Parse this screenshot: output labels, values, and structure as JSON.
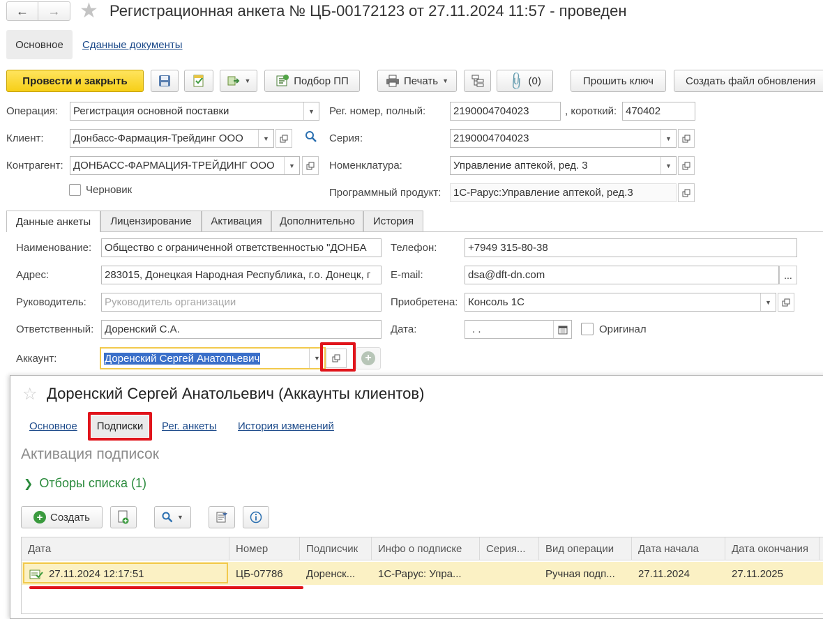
{
  "window": {
    "title": "Регистрационная анкета № ЦБ-00172123 от 27.11.2024 11:57 - проведен"
  },
  "top_nav": {
    "main_tab": "Основное",
    "docs_link": "Сданные документы"
  },
  "toolbar": {
    "post_close": "Провести и закрыть",
    "select_pp": "Подбор ПП",
    "print": "Печать",
    "attach_count": "(0)",
    "flash_key": "Прошить ключ",
    "create_update": "Создать файл обновления"
  },
  "form": {
    "operation_label": "Операция:",
    "operation_value": "Регистрация основной поставки",
    "client_label": "Клиент:",
    "client_value": "Донбасс-Фармация-Трейдинг ООО",
    "contractor_label": "Контрагент:",
    "contractor_value": "ДОНБАСС-ФАРМАЦИЯ-ТРЕЙДИНГ ООО",
    "draft_label": "Черновик",
    "reg_full_label": "Рег. номер, полный:",
    "reg_full_value": "2190004704023",
    "reg_short_label": ", короткий:",
    "reg_short_value": "470402",
    "series_label": "Серия:",
    "series_value": "2190004704023",
    "nomenclature_label": "Номенклатура:",
    "nomenclature_value": "Управление аптекой, ред. 3",
    "product_label": "Программный продукт:",
    "product_value": "1С-Рарус:Управление аптекой, ред.3"
  },
  "tabs": [
    "Данные анкеты",
    "Лицензирование",
    "Активация",
    "Дополнительно",
    "История"
  ],
  "anketa": {
    "name_label": "Наименование:",
    "name_value": "Общество с ограниченной ответственностью \"ДОНБА",
    "address_label": "Адрес:",
    "address_value": "283015, Донецкая Народная Республика, г.о. Донецк, г",
    "head_label": "Руководитель:",
    "head_placeholder": "Руководитель организации",
    "responsible_label": "Ответственный:",
    "responsible_value": "Доренский С.А.",
    "account_label": "Аккаунт:",
    "account_value": "Доренский Сергей Анатольевич",
    "phone_label": "Телефон:",
    "phone_value": "+7949 315-80-38",
    "email_label": "E-mail:",
    "email_value": "dsa@dft-dn.com",
    "email_btn": "...",
    "acquired_label": "Приобретена:",
    "acquired_value": "Консоль 1С",
    "date_label": "Дата:",
    "date_value": ". .",
    "original_label": "Оригинал"
  },
  "popup": {
    "title": "Доренский Сергей Анатольевич (Аккаунты клиентов)",
    "nav": [
      "Основное",
      "Подписки",
      "Рег. анкеты",
      "История изменений"
    ],
    "section_title": "Активация подписок",
    "filters": "Отборы списка (1)",
    "create_btn": "Создать",
    "columns": [
      "Дата",
      "Номер",
      "Подписчик",
      "Инфо о подписке",
      "Серия...",
      "Вид операции",
      "Дата начала",
      "Дата окончания"
    ],
    "rows": [
      [
        "27.11.2024 12:17:51",
        "ЦБ-07786",
        "Доренск...",
        "1С-Рарус: Упра...",
        "",
        "Ручная подп...",
        "27.11.2024",
        "27.11.2025"
      ]
    ]
  },
  "colors": {
    "primary_yellow": "#f6cf17",
    "highlight_red": "#e0141b",
    "row_highlight": "#fbf1c4",
    "link_blue": "#1c4a8a",
    "filter_green": "#2a8a3c"
  }
}
